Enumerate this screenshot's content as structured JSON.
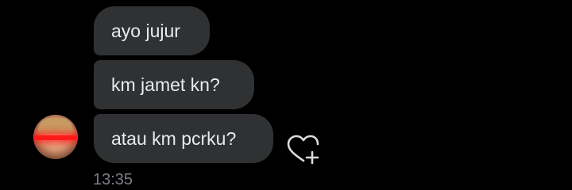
{
  "messages": [
    {
      "text": "ayo jujur"
    },
    {
      "text": "km jamet kn?"
    },
    {
      "text": "atau km pcrku?"
    }
  ],
  "timestamp": "13:35",
  "icons": {
    "react": "heart-plus-icon",
    "avatar": "avatar"
  },
  "colors": {
    "background": "#000000",
    "bubble": "#2f3133",
    "text": "#e9eaeb",
    "timestamp": "#7b7e83"
  }
}
